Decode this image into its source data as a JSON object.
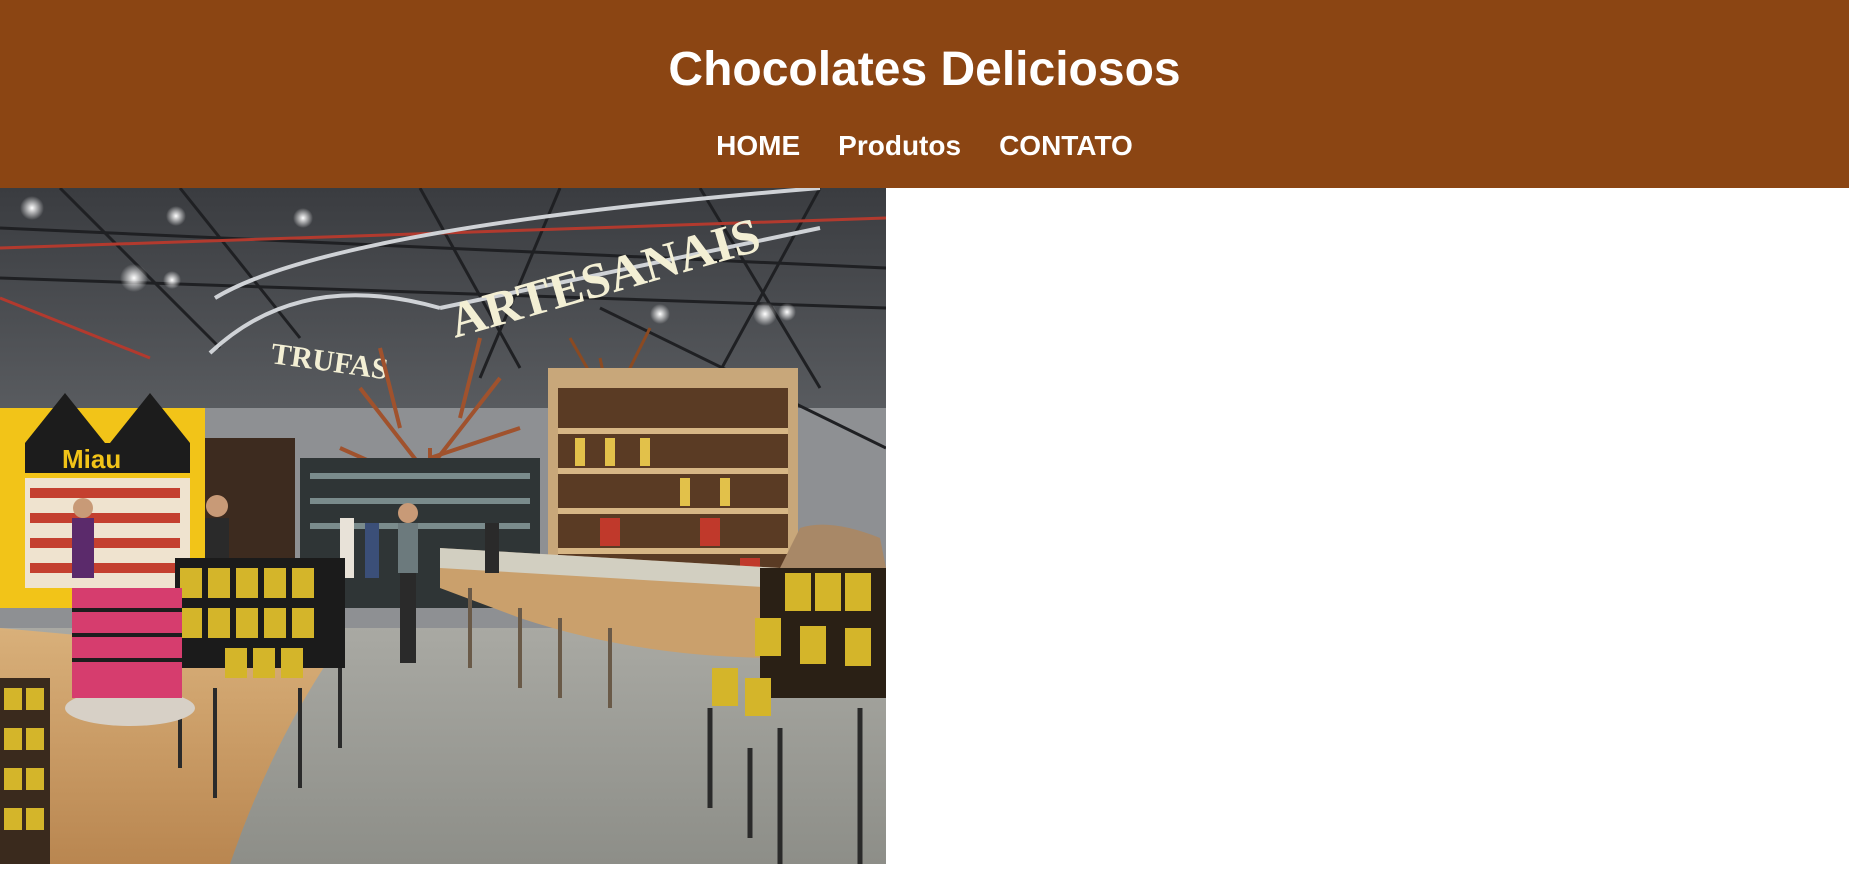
{
  "header": {
    "title": "Chocolates Deliciosos",
    "background_color": "#8b4513",
    "text_color": "#ffffff"
  },
  "nav": {
    "items": [
      {
        "label": "HOME"
      },
      {
        "label": "Produtos"
      },
      {
        "label": "CONTATO"
      }
    ]
  },
  "hero": {
    "signs": {
      "main": "ARTESANAIS",
      "secondary": "TRUFAS",
      "shop": "Miau"
    }
  }
}
